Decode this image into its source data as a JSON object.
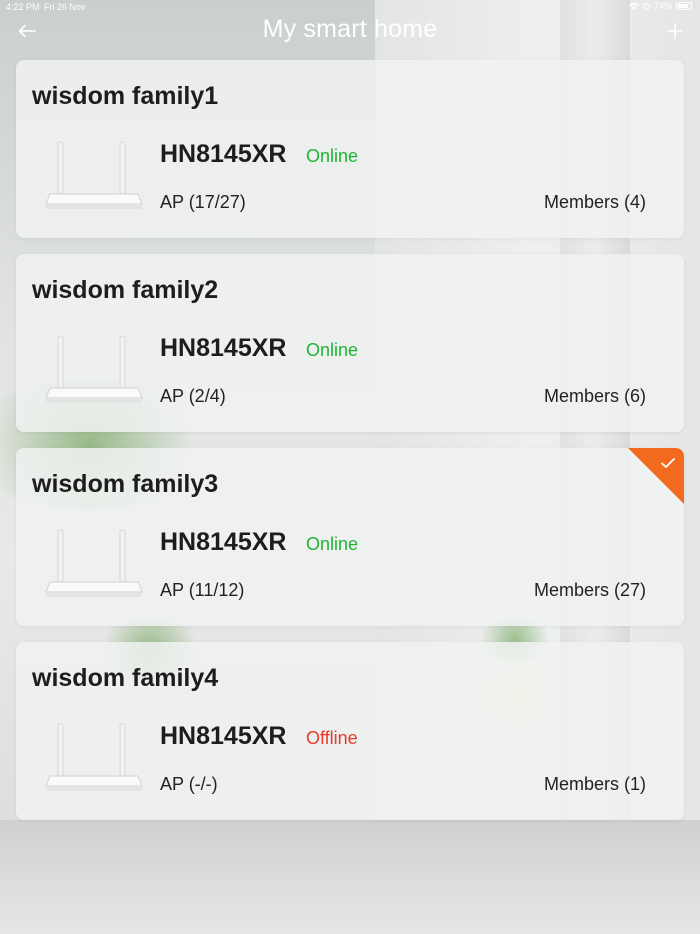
{
  "status_bar": {
    "time": "4:22 PM",
    "date": "Fri 26 Nov",
    "battery": "74%"
  },
  "header": {
    "title": "My smart home",
    "back_icon": "arrow-left-icon",
    "add_icon": "plus-icon"
  },
  "colors": {
    "online": "#1eb534",
    "offline": "#e83a2a",
    "selected_badge": "#f26a1f"
  },
  "families": [
    {
      "name": "wisdom family1",
      "device": "HN8145XR",
      "status": "Online",
      "status_type": "online",
      "ap": "AP (17/27)",
      "members": "Members (4)",
      "selected": false
    },
    {
      "name": "wisdom family2",
      "device": "HN8145XR",
      "status": "Online",
      "status_type": "online",
      "ap": "AP (2/4)",
      "members": "Members (6)",
      "selected": false
    },
    {
      "name": "wisdom family3",
      "device": "HN8145XR",
      "status": "Online",
      "status_type": "online",
      "ap": "AP (11/12)",
      "members": "Members (27)",
      "selected": true
    },
    {
      "name": "wisdom family4",
      "device": "HN8145XR",
      "status": "Offline",
      "status_type": "offline",
      "ap": "AP (-/-)",
      "members": "Members (1)",
      "selected": false
    }
  ]
}
